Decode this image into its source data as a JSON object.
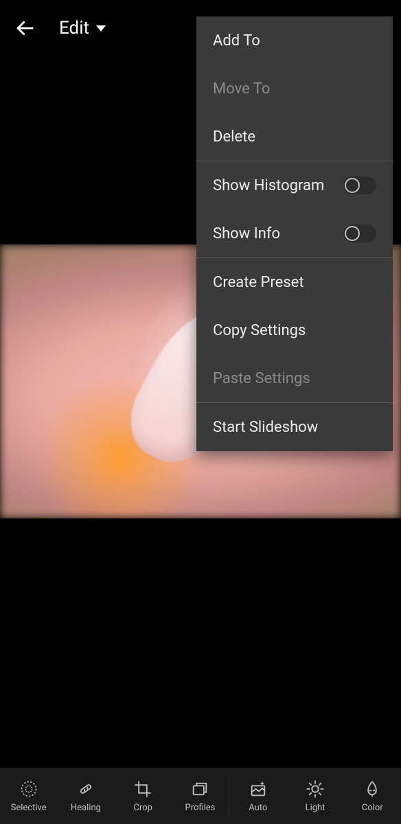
{
  "header": {
    "title_label": "Edit"
  },
  "menu": {
    "add_to": "Add To",
    "move_to": "Move To",
    "delete": "Delete",
    "show_histogram": "Show Histogram",
    "show_info": "Show Info",
    "create_preset": "Create Preset",
    "copy_settings": "Copy Settings",
    "paste_settings": "Paste Settings",
    "start_slideshow": "Start Slideshow",
    "show_histogram_on": false,
    "show_info_on": false
  },
  "toolbar": {
    "selective": "Selective",
    "healing": "Healing",
    "crop": "Crop",
    "profiles": "Profiles",
    "auto": "Auto",
    "light": "Light",
    "color": "Color"
  },
  "colors": {
    "menu_bg": "#3a3a3a",
    "menu_text": "#ececec",
    "menu_disabled_text": "#8a8a8a",
    "toolbar_bg": "#1a1a1a",
    "app_bg": "#000000"
  }
}
